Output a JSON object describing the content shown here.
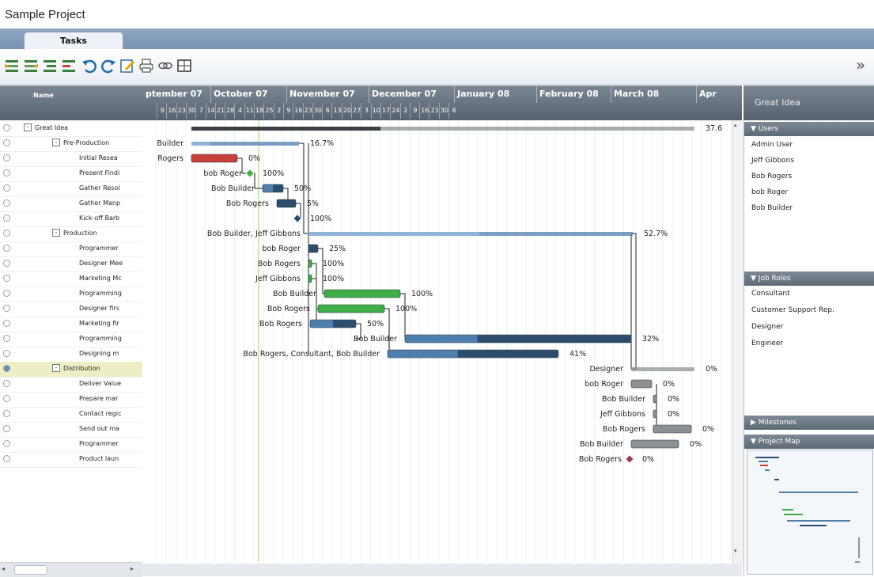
{
  "app": {
    "title": "Sample Project",
    "active_tab": "Tasks"
  },
  "toolbar": {
    "buttons": [
      "indent-icon",
      "outdent-icon",
      "add-task-icon",
      "add-subtask-icon",
      "undo-icon",
      "redo-icon",
      "edit-icon",
      "print-icon",
      "link-icon",
      "grid-icon"
    ],
    "expand_glyph": "»"
  },
  "grid": {
    "name_header": "Name"
  },
  "timeline": {
    "months": [
      "ptember 07",
      "October 07",
      "November 07",
      "December 07",
      "January 08",
      "February 08",
      "March 08",
      "Apr"
    ],
    "weeks": [
      "9",
      "16",
      "23",
      "30",
      "7",
      "14",
      "21",
      "28",
      "4",
      "11",
      "18",
      "25",
      "2",
      "9",
      "16",
      "23",
      "30",
      "6",
      "13",
      "20",
      "27",
      "3",
      "10",
      "17",
      "24",
      "2",
      "9",
      "16",
      "23",
      "30",
      "6"
    ],
    "top_percent": "37.6"
  },
  "tasks": [
    {
      "name": "Great Idea",
      "level": 0,
      "expand": "-",
      "assignee": "",
      "pct": "37.6"
    },
    {
      "name": "Pre-Production",
      "level": 1,
      "expand": "-",
      "assignee": "Builder",
      "pct": "16.7%"
    },
    {
      "name": "Initial Resea",
      "level": 2,
      "assignee": "Rogers",
      "pct": "0%"
    },
    {
      "name": "Present Findi",
      "level": 2,
      "assignee": "bob Roger",
      "pct": "100%"
    },
    {
      "name": "Gather Resol",
      "level": 2,
      "assignee": "Bob Builder",
      "pct": "50%"
    },
    {
      "name": "Gather Manp",
      "level": 2,
      "assignee": "Bob Rogers",
      "pct": "5%"
    },
    {
      "name": "Kick-off Barb",
      "level": 2,
      "assignee": "",
      "pct": "100%"
    },
    {
      "name": "Production",
      "level": 1,
      "expand": "-",
      "assignee": "Bob Builder, Jeff  Gibbons",
      "pct": "52.7%"
    },
    {
      "name": "Programmer",
      "level": 2,
      "assignee": "bob Roger",
      "pct": "25%"
    },
    {
      "name": "Designer Mee",
      "level": 2,
      "assignee": "Bob Rogers",
      "pct": "100%"
    },
    {
      "name": "Marketing Mc",
      "level": 2,
      "assignee": "Jeff  Gibbons",
      "pct": "100%"
    },
    {
      "name": "Programming",
      "level": 2,
      "assignee": "Bob Builder",
      "pct": "100%"
    },
    {
      "name": "Designer firs",
      "level": 2,
      "assignee": "Bob Rogers",
      "pct": "100%"
    },
    {
      "name": "Marketing fir",
      "level": 2,
      "assignee": "Bob Rogers",
      "pct": "50%"
    },
    {
      "name": "Programming",
      "level": 2,
      "assignee": "Bob Builder",
      "pct": "32%"
    },
    {
      "name": "Designing m",
      "level": 2,
      "assignee": "Bob Rogers, Consultant, Bob Builder",
      "pct": "41%"
    },
    {
      "name": "Distribution",
      "level": 1,
      "expand": "-",
      "assignee": "Designer",
      "pct": "0%",
      "selected": true
    },
    {
      "name": "Deliver Value",
      "level": 2,
      "assignee": "bob Roger",
      "pct": "0%"
    },
    {
      "name": "Prepare mar",
      "level": 2,
      "assignee": "Bob Builder",
      "pct": "0%"
    },
    {
      "name": "Contact regic",
      "level": 2,
      "assignee": "Jeff  Gibbons",
      "pct": "0%"
    },
    {
      "name": "Send out ma",
      "level": 2,
      "assignee": "Bob Rogers",
      "pct": "0%"
    },
    {
      "name": "Programmer",
      "level": 2,
      "assignee": "Bob Builder",
      "pct": "0%"
    },
    {
      "name": "Product laun",
      "level": 2,
      "assignee": "Bob Rogers",
      "pct": "0%"
    }
  ],
  "right_panel": {
    "header": "Great Idea",
    "users_title": "Users",
    "users": [
      "Admin User",
      "Jeff  Gibbons",
      "Bob Rogers",
      "bob Roger",
      "Bob Builder"
    ],
    "roles_title": "Job Roles",
    "roles": [
      "Consultant",
      "Customer Support Rep.",
      "Designer",
      "Engineer"
    ],
    "milestones_title": "Milestones",
    "map_title": "Project Map"
  },
  "colors": {
    "bar_blue": "#4f7fae",
    "bar_dark": "#2d4d6d",
    "bar_green": "#3fae46",
    "bar_red": "#c8403a",
    "bar_gray": "#8d9194",
    "milestone": "#9b3b5c"
  }
}
